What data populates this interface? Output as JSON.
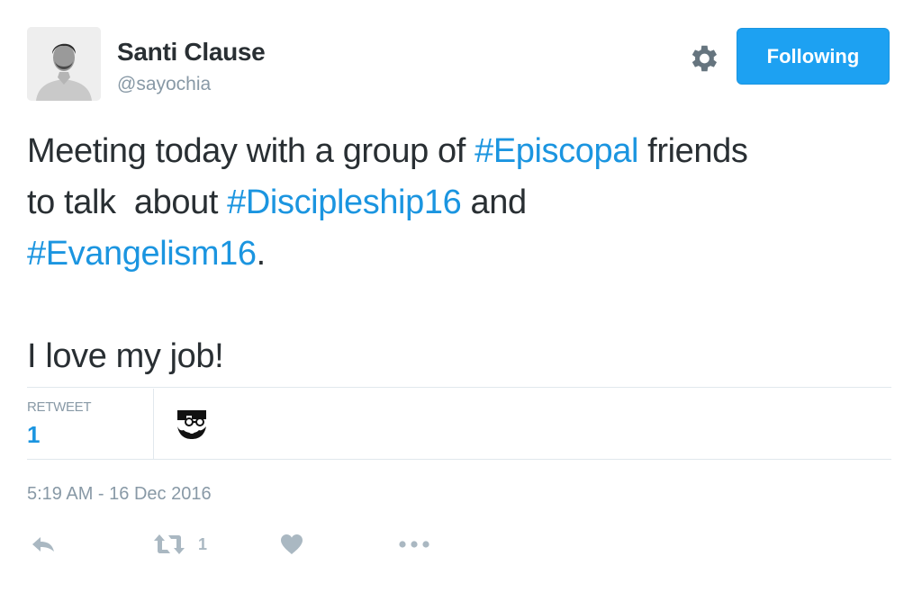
{
  "user": {
    "display_name": "Santi Clause",
    "handle": "@sayochia",
    "avatar_icon": "user-avatar-photo"
  },
  "header": {
    "settings_icon": "gear-icon",
    "follow_label": "Following",
    "follow_color": "#1da1f2"
  },
  "tweet": {
    "line1_pre": "Meeting today with a group of ",
    "tag_episcopal": "#Episcopal",
    "line1_post": " friends",
    "line2_pre": "to talk  about ",
    "tag_discipleship": "#Discipleship16",
    "line2_post": " and",
    "tag_evangelism": "#Evangelism16",
    "line3_post": ".",
    "line4": "I love my job!",
    "hashtag_color": "#1b95e0"
  },
  "stats": {
    "retweet_label": "RETWEET",
    "retweet_value": "1",
    "retweeter_icon": "retweeter-avatar"
  },
  "timestamp": "5:19 AM - 16 Dec 2016",
  "actions": {
    "reply_icon": "reply-icon",
    "retweet_icon": "retweet-icon",
    "retweet_count": "1",
    "like_icon": "heart-icon",
    "more_icon": "more-dots-icon"
  }
}
